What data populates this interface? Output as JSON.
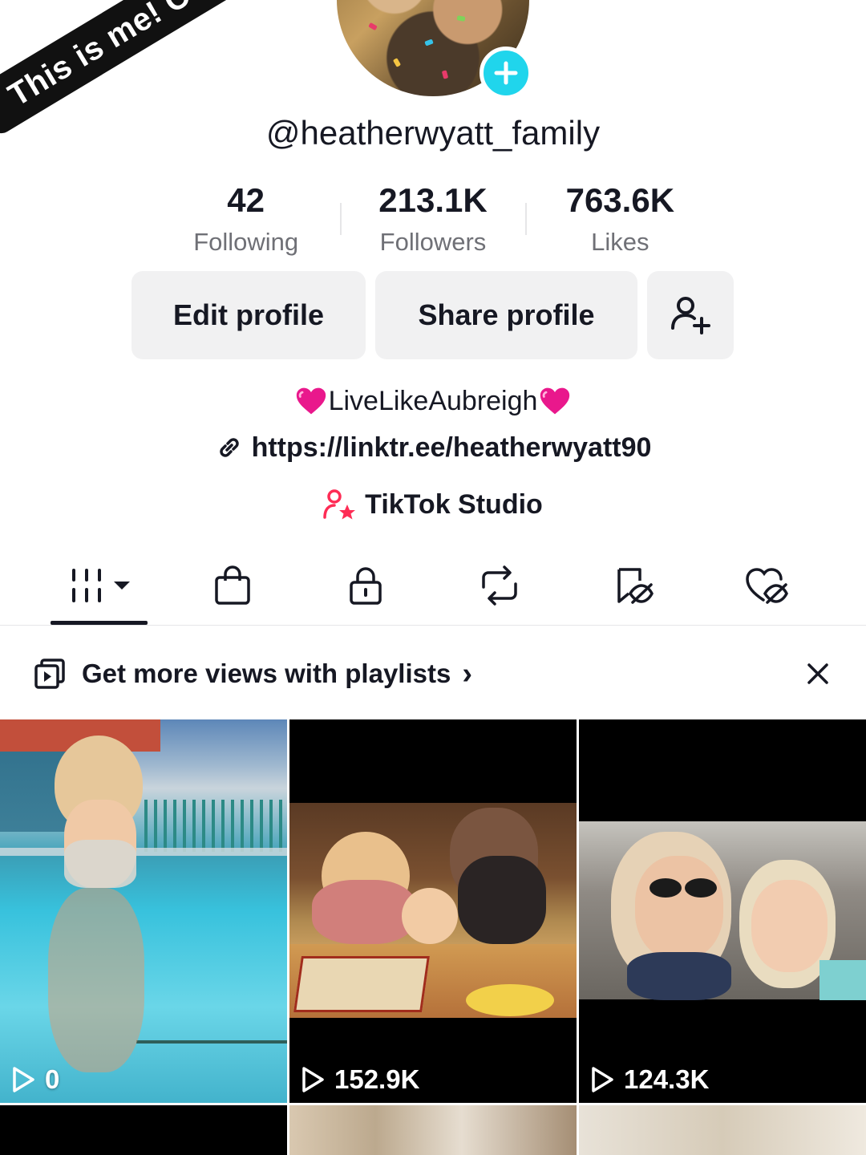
{
  "caption_sticker": {
    "text": "This is me! Caption",
    "emoji": "pink-heart"
  },
  "profile": {
    "username": "@heatherwyatt_family",
    "stats": [
      {
        "value": "42",
        "label": "Following"
      },
      {
        "value": "213.1K",
        "label": "Followers"
      },
      {
        "value": "763.6K",
        "label": "Likes"
      }
    ],
    "buttons": {
      "edit": "Edit profile",
      "share": "Share profile"
    },
    "bio": "LiveLikeAubreigh",
    "link": "https://linktr.ee/heatherwyatt90",
    "studio": "TikTok Studio"
  },
  "tabs": [
    {
      "icon": "grid-icon",
      "active": true
    },
    {
      "icon": "shopping-bag-icon",
      "active": false
    },
    {
      "icon": "lock-icon",
      "active": false
    },
    {
      "icon": "repost-icon",
      "active": false
    },
    {
      "icon": "bookmark-hidden-icon",
      "active": false
    },
    {
      "icon": "heart-hidden-icon",
      "active": false
    }
  ],
  "playlist_banner": {
    "text": "Get more views with playlists",
    "chevron": "›"
  },
  "videos": [
    {
      "views": "0"
    },
    {
      "views": "152.9K"
    },
    {
      "views": "124.3K"
    }
  ],
  "colors": {
    "accent": "#20d5ec",
    "studio_pink": "#fe2c55",
    "heart": "#e9188c"
  }
}
